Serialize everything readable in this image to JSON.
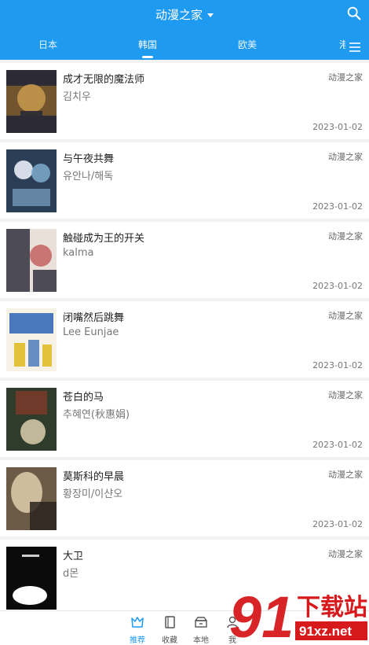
{
  "header": {
    "title": "动漫之家",
    "search_icon": "search-icon",
    "menu_icon": "hamburger-menu-icon"
  },
  "tabs": [
    {
      "label": "日本"
    },
    {
      "label": "韩国"
    },
    {
      "label": "欧美"
    },
    {
      "label": "港"
    }
  ],
  "active_tab_index": 1,
  "items": [
    {
      "name": "成才无限的魔法师",
      "author": "김치우",
      "source": "动漫之家",
      "date": "2023-01-02",
      "cover_palette": [
        "#7a5a2e",
        "#c79a4c",
        "#2b2a35"
      ]
    },
    {
      "name": "与午夜共舞",
      "author": "유안나/해독",
      "source": "动漫之家",
      "date": "2023-01-02",
      "cover_palette": [
        "#2a3f55",
        "#7aa5c6",
        "#d7dde6"
      ]
    },
    {
      "name": "触碰成为王的开关",
      "author": "kalma",
      "source": "动漫之家",
      "date": "2023-01-02",
      "cover_palette": [
        "#3c3b46",
        "#c25a5a",
        "#e9e0d9"
      ]
    },
    {
      "name": "闭嘴然后跳舞",
      "author": "Lee Eunjae",
      "source": "动漫之家",
      "date": "2023-01-02",
      "cover_palette": [
        "#f6f3e6",
        "#2b62b4",
        "#e2c23a"
      ]
    },
    {
      "name": "苍白的马",
      "author": "추혜연(秋惠娟)",
      "source": "动漫之家",
      "date": "2023-01-02",
      "cover_palette": [
        "#2f3c2c",
        "#7a3a2a",
        "#d2c5a6"
      ]
    },
    {
      "name": "莫斯科的早晨",
      "author": "황장미/이샨오",
      "source": "动漫之家",
      "date": "2023-01-02",
      "cover_palette": [
        "#6b5a45",
        "#d9c7a6",
        "#2a241e"
      ]
    },
    {
      "name": "大卫",
      "author": "d몬",
      "source": "动漫之家",
      "date": "",
      "cover_palette": [
        "#0b0b0b",
        "#ffffff",
        "#1a1a1a"
      ]
    }
  ],
  "bottom_nav": [
    {
      "label": "推荐",
      "icon": "recommend-icon"
    },
    {
      "label": "收藏",
      "icon": "bookmark-book-icon"
    },
    {
      "label": "本地",
      "icon": "local-storage-icon"
    },
    {
      "label": "我",
      "icon": "profile-icon"
    }
  ],
  "active_bottom_index": 0,
  "watermark": {
    "primary": "下载站",
    "secondary": "91xz.net"
  },
  "colors": {
    "accent": "#1e9af0",
    "watermark_red": "#d7191c"
  }
}
